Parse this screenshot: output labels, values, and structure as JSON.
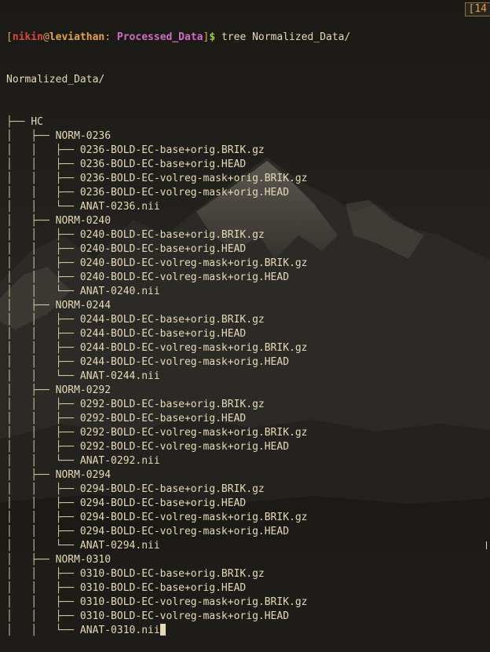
{
  "prompt": {
    "open_bracket": "[",
    "user": "nikin",
    "at": "@",
    "host": "leviathan",
    "colon": ":",
    "dir": " Processed_Data",
    "close_bracket": "]",
    "dollar": "$",
    "command": " tree Normalized_Data/"
  },
  "badge": "[14",
  "root": "Normalized_Data/",
  "tree": [
    {
      "guide": "├── ",
      "name": "HC"
    },
    {
      "guide": "│   ├── ",
      "name": "NORM-0236"
    },
    {
      "guide": "│   │   ├── ",
      "name": "0236-BOLD-EC-base+orig.BRIK.gz"
    },
    {
      "guide": "│   │   ├── ",
      "name": "0236-BOLD-EC-base+orig.HEAD"
    },
    {
      "guide": "│   │   ├── ",
      "name": "0236-BOLD-EC-volreg-mask+orig.BRIK.gz"
    },
    {
      "guide": "│   │   ├── ",
      "name": "0236-BOLD-EC-volreg-mask+orig.HEAD"
    },
    {
      "guide": "│   │   └── ",
      "name": "ANAT-0236.nii"
    },
    {
      "guide": "│   ├── ",
      "name": "NORM-0240"
    },
    {
      "guide": "│   │   ├── ",
      "name": "0240-BOLD-EC-base+orig.BRIK.gz"
    },
    {
      "guide": "│   │   ├── ",
      "name": "0240-BOLD-EC-base+orig.HEAD"
    },
    {
      "guide": "│   │   ├── ",
      "name": "0240-BOLD-EC-volreg-mask+orig.BRIK.gz"
    },
    {
      "guide": "│   │   ├── ",
      "name": "0240-BOLD-EC-volreg-mask+orig.HEAD"
    },
    {
      "guide": "│   │   └── ",
      "name": "ANAT-0240.nii"
    },
    {
      "guide": "│   ├── ",
      "name": "NORM-0244"
    },
    {
      "guide": "│   │   ├── ",
      "name": "0244-BOLD-EC-base+orig.BRIK.gz"
    },
    {
      "guide": "│   │   ├── ",
      "name": "0244-BOLD-EC-base+orig.HEAD"
    },
    {
      "guide": "│   │   ├── ",
      "name": "0244-BOLD-EC-volreg-mask+orig.BRIK.gz"
    },
    {
      "guide": "│   │   ├── ",
      "name": "0244-BOLD-EC-volreg-mask+orig.HEAD"
    },
    {
      "guide": "│   │   └── ",
      "name": "ANAT-0244.nii"
    },
    {
      "guide": "│   ├── ",
      "name": "NORM-0292"
    },
    {
      "guide": "│   │   ├── ",
      "name": "0292-BOLD-EC-base+orig.BRIK.gz"
    },
    {
      "guide": "│   │   ├── ",
      "name": "0292-BOLD-EC-base+orig.HEAD"
    },
    {
      "guide": "│   │   ├── ",
      "name": "0292-BOLD-EC-volreg-mask+orig.BRIK.gz"
    },
    {
      "guide": "│   │   ├── ",
      "name": "0292-BOLD-EC-volreg-mask+orig.HEAD"
    },
    {
      "guide": "│   │   └── ",
      "name": "ANAT-0292.nii"
    },
    {
      "guide": "│   ├── ",
      "name": "NORM-0294"
    },
    {
      "guide": "│   │   ├── ",
      "name": "0294-BOLD-EC-base+orig.BRIK.gz"
    },
    {
      "guide": "│   │   ├── ",
      "name": "0294-BOLD-EC-base+orig.HEAD"
    },
    {
      "guide": "│   │   ├── ",
      "name": "0294-BOLD-EC-volreg-mask+orig.BRIK.gz"
    },
    {
      "guide": "│   │   ├── ",
      "name": "0294-BOLD-EC-volreg-mask+orig.HEAD"
    },
    {
      "guide": "│   │   └── ",
      "name": "ANAT-0294.nii"
    },
    {
      "guide": "│   ├── ",
      "name": "NORM-0310"
    },
    {
      "guide": "│   │   ├── ",
      "name": "0310-BOLD-EC-base+orig.BRIK.gz"
    },
    {
      "guide": "│   │   ├── ",
      "name": "0310-BOLD-EC-base+orig.HEAD"
    },
    {
      "guide": "│   │   ├── ",
      "name": "0310-BOLD-EC-volreg-mask+orig.BRIK.gz"
    },
    {
      "guide": "│   │   ├── ",
      "name": "0310-BOLD-EC-volreg-mask+orig.HEAD"
    },
    {
      "guide": "│   │   └── ",
      "name": "ANAT-0310.nii"
    }
  ]
}
